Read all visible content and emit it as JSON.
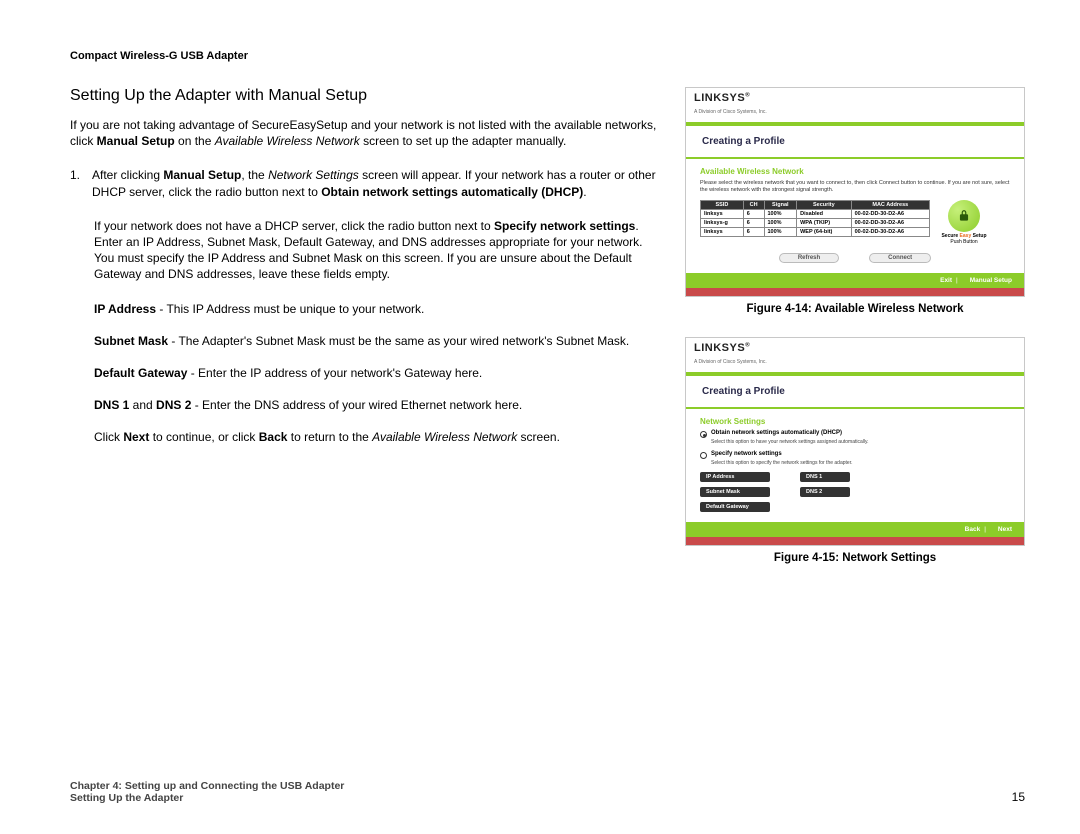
{
  "header": {
    "doc_title": "Compact Wireless-G USB Adapter"
  },
  "main": {
    "section_title": "Setting Up the Adapter with Manual Setup",
    "intro_html": "If you are not taking advantage of SecureEasySetup and your network is not listed with the available networks, click <b>Manual Setup</b> on the <em>Available Wireless Network</em> screen to set up the adapter manually.",
    "step1_html": "After clicking <b>Manual Setup</b>, the <em>Network Settings</em> screen will appear. If your network has a router or other DHCP server, click the radio button next to <b>Obtain network settings automatically (DHCP)</b>.",
    "step1_num": "1.",
    "para2_html": "If your network does not have a DHCP server, click the radio button next to <b>Specify network settings</b>. Enter an IP Address, Subnet Mask, Default Gateway, and DNS addresses appropriate for your network. You must specify the IP Address and Subnet Mask on this screen. If you are unsure about the Default Gateway and DNS addresses, leave these fields empty.",
    "def_ip_html": "<b>IP Address</b> - This IP Address must be unique to your network.",
    "def_subnet_html": "<b>Subnet Mask</b> - The Adapter's Subnet Mask must be the same as your wired network's Subnet Mask.",
    "def_gw_html": "<b>Default Gateway</b> - Enter the IP address of your network's Gateway here.",
    "def_dns_html": "<b>DNS 1</b> and <b>DNS 2</b> - Enter the DNS address of your wired Ethernet network here.",
    "closing_html": "Click <b>Next</b> to continue, or click <b>Back</b> to return to the <em>Available Wireless Network</em> screen."
  },
  "fig1": {
    "caption": "Figure 4-14: Available Wireless Network",
    "brand": "LINKSYS",
    "brand_sub": "A Division of Cisco Systems, Inc.",
    "band_title": "Creating a Profile",
    "sec_title": "Available Wireless Network",
    "intro": "Please select the wireless network that you want to connect to, then click Connect button to continue. If you are not sure, select the wireless network with the strongest signal strength.",
    "headers": [
      "SSID",
      "CH",
      "Signal",
      "Security",
      "MAC Address"
    ],
    "rows": [
      [
        "linksys",
        "6",
        "100%",
        "Disabled",
        "00-02-DD-30-D2-A6"
      ],
      [
        "linksys-g",
        "6",
        "100%",
        "WPA (TKIP)",
        "00-02-DD-30-D2-A6"
      ],
      [
        "linksys",
        "6",
        "100%",
        "WEP (64-bit)",
        "00-02-DD-30-D2-A6"
      ]
    ],
    "lock_l1": "Secure",
    "lock_l2_orange": "Easy",
    "lock_l2b": "Setup",
    "lock_l3": "Push Button",
    "btn_refresh": "Refresh",
    "btn_connect": "Connect",
    "foot_exit": "Exit",
    "foot_manual": "Manual Setup"
  },
  "fig2": {
    "caption": "Figure 4-15: Network Settings",
    "brand": "LINKSYS",
    "brand_sub": "A Division of Cisco Systems, Inc.",
    "band_title": "Creating a Profile",
    "sec_title": "Network Settings",
    "r1_label": "Obtain network settings automatically (DHCP)",
    "r1_sub": "Select this option to have your network settings assigned automatically.",
    "r2_label": "Specify network settings",
    "r2_sub": "Select this option to specify the network settings for the adapter.",
    "chip_ip": "IP Address",
    "chip_mask": "Subnet Mask",
    "chip_gw": "Default Gateway",
    "chip_d1": "DNS 1",
    "chip_d2": "DNS 2",
    "foot_back": "Back",
    "foot_next": "Next"
  },
  "footer": {
    "line1": "Chapter 4: Setting up and Connecting the USB Adapter",
    "line2": "Setting Up the Adapter",
    "page": "15"
  }
}
